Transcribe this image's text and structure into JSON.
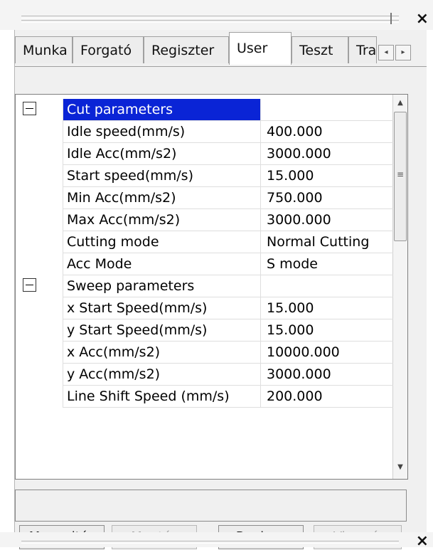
{
  "tabs": [
    "Munka",
    "Forgató",
    "Regiszter",
    "User",
    "Teszt",
    "Tra"
  ],
  "active_tab": "User",
  "tab_scroll": {
    "left": "◂",
    "right": "▸"
  },
  "close_glyph": "×",
  "properties": [
    {
      "type": "group",
      "name": "Cut parameters",
      "value": "",
      "selected": true
    },
    {
      "type": "item",
      "name": "Idle speed(mm/s)",
      "value": "400.000"
    },
    {
      "type": "item",
      "name": "Idle Acc(mm/s2)",
      "value": "3000.000"
    },
    {
      "type": "item",
      "name": "Start speed(mm/s)",
      "value": "15.000"
    },
    {
      "type": "item",
      "name": "Min Acc(mm/s2)",
      "value": "750.000"
    },
    {
      "type": "item",
      "name": "Max Acc(mm/s2)",
      "value": "3000.000"
    },
    {
      "type": "item",
      "name": "Cutting mode",
      "value": "Normal Cutting"
    },
    {
      "type": "item",
      "name": "Acc Mode",
      "value": "S mode"
    },
    {
      "type": "group",
      "name": "Sweep parameters",
      "value": ""
    },
    {
      "type": "item",
      "name": "x Start Speed(mm/s)",
      "value": "15.000"
    },
    {
      "type": "item",
      "name": "y Start Speed(mm/s)",
      "value": "15.000"
    },
    {
      "type": "item",
      "name": "x Acc(mm/s2)",
      "value": "10000.000"
    },
    {
      "type": "item",
      "name": "y Acc(mm/s2)",
      "value": "3000.000"
    },
    {
      "type": "item",
      "name": "Line Shift Speed (mm/s)",
      "value": "200.000"
    }
  ],
  "scrollbar": {
    "up": "▲",
    "down": "▼",
    "grip": "≡"
  },
  "buttons": [
    {
      "label": "Megnyitás",
      "enabled": true
    },
    {
      "label": "Mentés",
      "enabled": false
    },
    {
      "label": "Beolvas",
      "enabled": true
    },
    {
      "label": "Visszaír",
      "enabled": false
    }
  ],
  "colors": {
    "selection": "#0a24d6",
    "panel": "#f0f0f0",
    "grid_line": "#dedede"
  }
}
